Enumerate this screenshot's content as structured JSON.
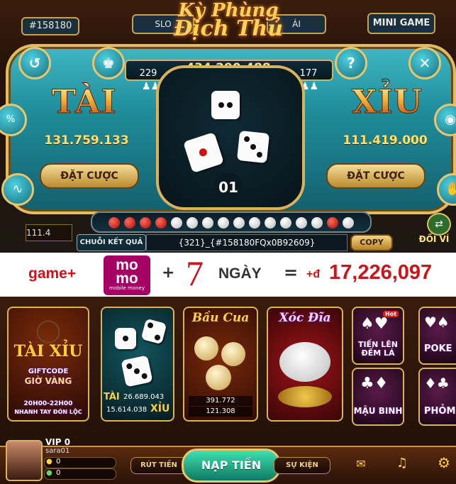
{
  "game": {
    "session_id": "#158180",
    "title_line1": "Kỳ Phùng",
    "title_line2": "Địch Thủ",
    "mini_game_label": "MINI GAME",
    "total_pot": "434.290.488",
    "players_left": "229",
    "players_right": "177",
    "tai_label": "TÀI",
    "xiu_label": "XỈU",
    "tai_amount": "131.759.133",
    "xiu_amount": "111.419.000",
    "bet_left_label": "ĐẶT CƯỢC",
    "bet_right_label": "ĐẶT CƯỢC",
    "countdown": "01",
    "history_label": "CHUỖI KẾT QUẢ",
    "result_code": "{321}_{#158180FQx0B92609}",
    "copy_label": "COPY",
    "exchange_label": "ĐỔI VÍ",
    "left_peek_value": "111.4",
    "history_dots": [
      "red",
      "red",
      "red",
      "red",
      "white",
      "white",
      "white",
      "white",
      "white",
      "white",
      "white",
      "white",
      "white",
      "white",
      "red",
      "white"
    ],
    "icons": {
      "history": "history-icon",
      "leaderboard": "trophy-icon",
      "help": "question-icon",
      "close": "close-icon",
      "chart": "trend-chart-icon",
      "hand": "hand-icon"
    }
  },
  "promo": {
    "prefix": "game+",
    "brand_top": "mo",
    "brand_bottom": "mo",
    "brand_sub": "mobile money",
    "plus": "+",
    "days_number": "7",
    "days_label": "NGÀY",
    "equals": "=",
    "plus_currency": "+đ",
    "amount": "17,226,097"
  },
  "lobby": {
    "featured": {
      "title": "TÀI XỈU",
      "line1": "GIFTCODE",
      "line2": "GIỜ VÀNG",
      "hours": "20H00-22H00",
      "tagline": "NHANH TAY ĐÓN LỘC"
    },
    "taixiu_card": {
      "tai_label": "TÀI",
      "xiu_label": "XỈU",
      "tai_value": "26.689.043",
      "xiu_value": "15.614.038"
    },
    "baucua_card": {
      "title": "Bầu Cua",
      "value1": "391.772",
      "value2": "121.308"
    },
    "xocdia_card": {
      "title": "Xóc Đĩa"
    },
    "side_games": [
      {
        "label": "TIẾN LÊN ĐẾM LÁ",
        "badge": "Hot"
      },
      {
        "label": "MẬU BINH"
      },
      {
        "label": "POKE"
      },
      {
        "label": "PHỎM"
      }
    ],
    "user": {
      "vip": "VIP 0",
      "name": "sara01",
      "balance1": "0",
      "balance2": "0"
    },
    "nav": {
      "withdraw": "RÚT TIỀN",
      "deposit": "NẠP TIỀN",
      "events": "SỰ KIỆN"
    }
  },
  "colors": {
    "teal": "#1f8c9a",
    "gold": "#e1bc62",
    "promo_red": "#d0121b",
    "momo_pink": "#a50064"
  }
}
